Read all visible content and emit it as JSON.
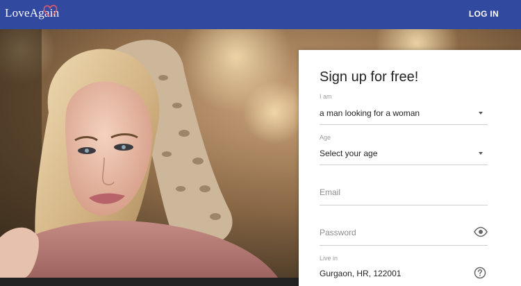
{
  "header": {
    "logo": "LoveAgain",
    "login": "LOG IN"
  },
  "form": {
    "title": "Sign up for free!",
    "iam": {
      "label": "I am",
      "value": "a man looking for a woman"
    },
    "age": {
      "label": "Age",
      "value": "Select your age"
    },
    "email": {
      "placeholder": "Email"
    },
    "password": {
      "placeholder": "Password"
    },
    "live_in": {
      "label": "Live in",
      "value": "Gurgaon, HR, 122001"
    }
  },
  "colors": {
    "header": "#3249a0",
    "heart": "#e05a6a"
  },
  "icons": {
    "logo": "heart-icon",
    "dropdown": "caret-down-icon",
    "password_toggle": "eye-icon",
    "help": "question-circle-icon"
  }
}
